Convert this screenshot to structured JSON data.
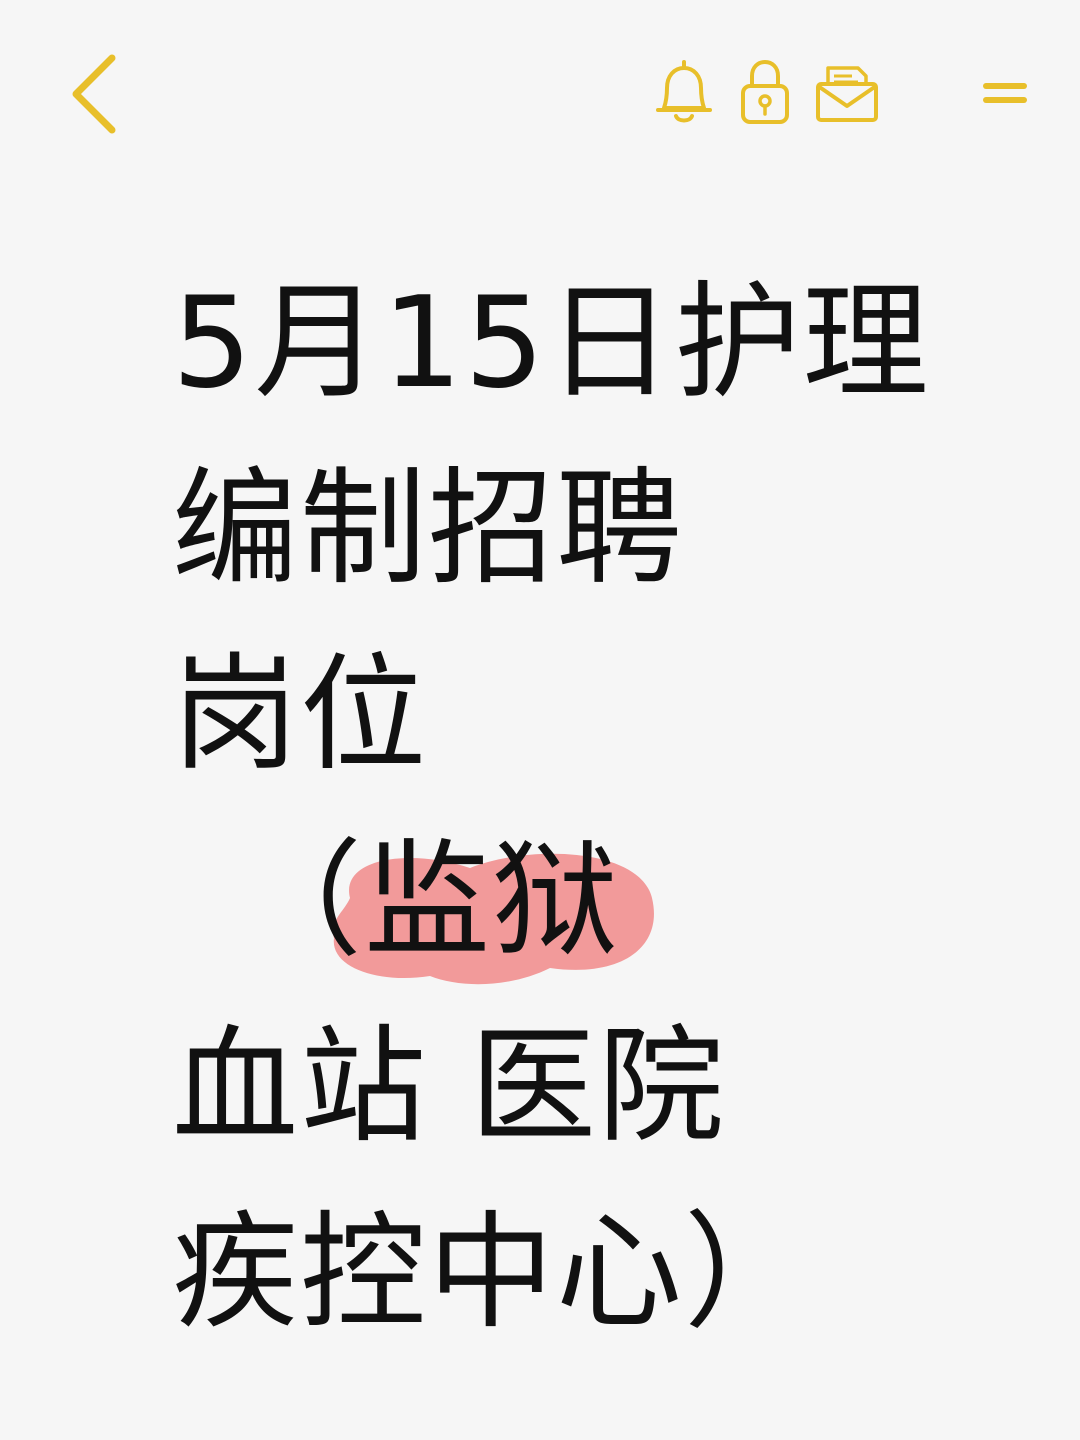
{
  "toolbar": {
    "accent_color": "#e8bf2a",
    "icons": [
      "chevron-left-icon",
      "bell-icon",
      "lock-icon",
      "envelope-icon",
      "menu-icon"
    ]
  },
  "note": {
    "lines": [
      "5月15日护理",
      "编制招聘",
      "岗位"
    ],
    "highlight_line": {
      "open_paren": "（",
      "highlighted": "监狱",
      "highlight_color": "#f29a9a"
    },
    "line5": "血站 医院",
    "line6": "疾控中心）"
  }
}
